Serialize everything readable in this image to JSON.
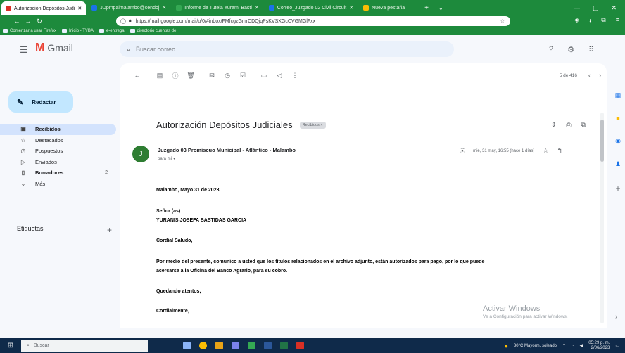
{
  "browser": {
    "tabs": [
      {
        "title": "Autorización Depósitos Judi",
        "active": true,
        "color": "#d93025"
      },
      {
        "title": "JDpmpalmalambo@cendoj",
        "active": false,
        "color": "#1a73e8"
      },
      {
        "title": "Informe de Tutela Yurami Basti",
        "active": false,
        "color": "#34a853"
      },
      {
        "title": "Correo_Juzgado 02 Civil Circuit",
        "active": false,
        "color": "#1a73e8"
      },
      {
        "title": "Nueva pestaña",
        "active": false,
        "color": "#fbbc04"
      }
    ],
    "url": "https://mail.google.com/mail/u/0/#inbox/FMfcgzGmrCDQjqPsKVSXGcCVGMGlFxx",
    "bookmarks": [
      "Comenzar a usar Firefox",
      "Inicio - TYBA",
      "e-entrega",
      "directorio cuentas de"
    ]
  },
  "gmail": {
    "app_name": "Gmail",
    "search_placeholder": "Buscar correo",
    "compose_label": "Redactar",
    "nav": [
      {
        "label": "Recibidos",
        "icon": "inbox-icon",
        "glyph": "▣",
        "count": "",
        "active": true
      },
      {
        "label": "Destacados",
        "icon": "star-icon",
        "glyph": "☆",
        "count": "",
        "active": false
      },
      {
        "label": "Pospuestos",
        "icon": "clock-icon",
        "glyph": "◷",
        "count": "",
        "active": false
      },
      {
        "label": "Enviados",
        "icon": "send-icon",
        "glyph": "▷",
        "count": "",
        "active": false
      },
      {
        "label": "Borradores",
        "icon": "draft-icon",
        "glyph": "▯",
        "count": "2",
        "active": false
      },
      {
        "label": "Más",
        "icon": "chevron-down-icon",
        "glyph": "⌄",
        "count": "",
        "active": false
      }
    ],
    "labels_title": "Etiquetas",
    "counter": "5 de 416"
  },
  "email": {
    "subject": "Autorización Depósitos Judiciales",
    "label_chip": "Recibidos ×",
    "sender": "Juzgado 03 Promiscuo Municipal - Atlántico - Malambo",
    "to_me": "para mí ▾",
    "avatar_letter": "J",
    "date": "mié, 31 may, 16:55 (hace 1 días)",
    "body": [
      "Malambo, Mayo 31 de 2023.",
      "Señor (as):",
      "YURANIS JOSEFA BASTIDAS GARCIA",
      "Cordial Saludo,",
      "Por medio del presente, comunico a usted  que los títulos relacionados en el archivo adjunto, están autorizados para pago, por lo que puede",
      "acercarse a la Oficina del Banco Agrario, para su cobro.",
      "Quedando atentos,",
      "Cordialmente,"
    ]
  },
  "watermark": {
    "title": "Activar Windows",
    "subtitle": "Ve a Configuración para activar Windows."
  },
  "taskbar": {
    "search": "Buscar",
    "weather": "30°C  Mayorm. soleado",
    "time": "05:29 p. m.",
    "date": "2/06/2023"
  }
}
